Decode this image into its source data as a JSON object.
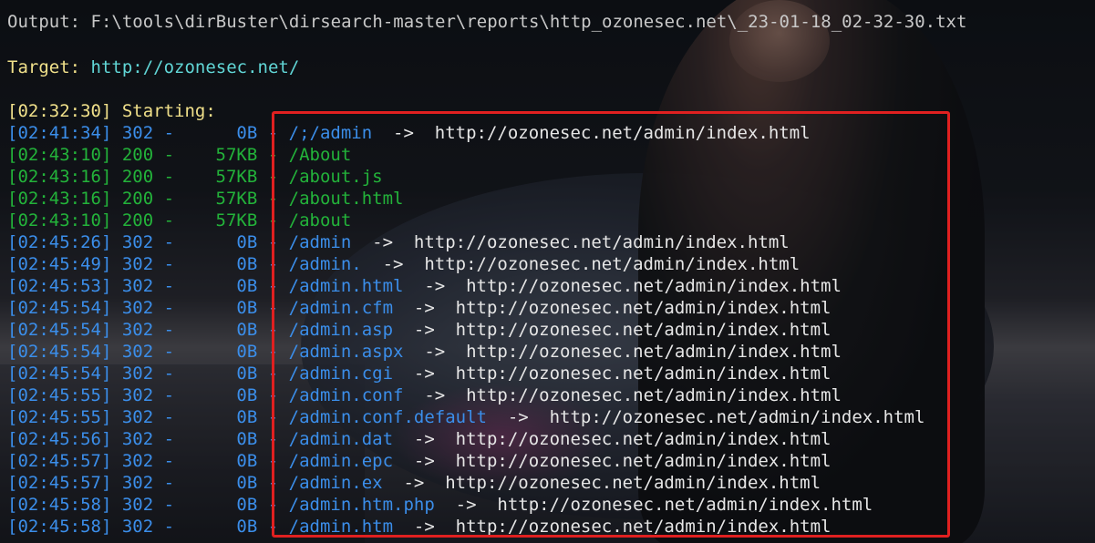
{
  "output": {
    "label": "Output:",
    "path": "F:\\tools\\dirBuster\\dirsearch-master\\reports\\http_ozonesec.net\\_23-01-18_02-32-30.txt"
  },
  "target": {
    "label": "Target:",
    "url": "http://ozonesec.net/"
  },
  "starting": {
    "time": "[02:32:30]",
    "text": "Starting:"
  },
  "rows": [
    {
      "time": "[02:41:34]",
      "status": "302",
      "size": "0B",
      "path": "/;/admin",
      "redirect": "http://ozonesec.net/admin/index.html"
    },
    {
      "time": "[02:43:10]",
      "status": "200",
      "size": "57KB",
      "path": "/About",
      "redirect": ""
    },
    {
      "time": "[02:43:16]",
      "status": "200",
      "size": "57KB",
      "path": "/about.js",
      "redirect": ""
    },
    {
      "time": "[02:43:16]",
      "status": "200",
      "size": "57KB",
      "path": "/about.html",
      "redirect": ""
    },
    {
      "time": "[02:43:10]",
      "status": "200",
      "size": "57KB",
      "path": "/about",
      "redirect": ""
    },
    {
      "time": "[02:45:26]",
      "status": "302",
      "size": "0B",
      "path": "/admin",
      "redirect": "http://ozonesec.net/admin/index.html"
    },
    {
      "time": "[02:45:49]",
      "status": "302",
      "size": "0B",
      "path": "/admin.",
      "redirect": "http://ozonesec.net/admin/index.html"
    },
    {
      "time": "[02:45:53]",
      "status": "302",
      "size": "0B",
      "path": "/admin.html",
      "redirect": "http://ozonesec.net/admin/index.html"
    },
    {
      "time": "[02:45:54]",
      "status": "302",
      "size": "0B",
      "path": "/admin.cfm",
      "redirect": "http://ozonesec.net/admin/index.html"
    },
    {
      "time": "[02:45:54]",
      "status": "302",
      "size": "0B",
      "path": "/admin.asp",
      "redirect": "http://ozonesec.net/admin/index.html"
    },
    {
      "time": "[02:45:54]",
      "status": "302",
      "size": "0B",
      "path": "/admin.aspx",
      "redirect": "http://ozonesec.net/admin/index.html"
    },
    {
      "time": "[02:45:54]",
      "status": "302",
      "size": "0B",
      "path": "/admin.cgi",
      "redirect": "http://ozonesec.net/admin/index.html"
    },
    {
      "time": "[02:45:55]",
      "status": "302",
      "size": "0B",
      "path": "/admin.conf",
      "redirect": "http://ozonesec.net/admin/index.html"
    },
    {
      "time": "[02:45:55]",
      "status": "302",
      "size": "0B",
      "path": "/admin.conf.default",
      "redirect": "http://ozonesec.net/admin/index.html"
    },
    {
      "time": "[02:45:56]",
      "status": "302",
      "size": "0B",
      "path": "/admin.dat",
      "redirect": "http://ozonesec.net/admin/index.html"
    },
    {
      "time": "[02:45:57]",
      "status": "302",
      "size": "0B",
      "path": "/admin.epc",
      "redirect": "http://ozonesec.net/admin/index.html"
    },
    {
      "time": "[02:45:57]",
      "status": "302",
      "size": "0B",
      "path": "/admin.ex",
      "redirect": "http://ozonesec.net/admin/index.html"
    },
    {
      "time": "[02:45:58]",
      "status": "302",
      "size": "0B",
      "path": "/admin.htm.php",
      "redirect": "http://ozonesec.net/admin/index.html"
    },
    {
      "time": "[02:45:58]",
      "status": "302",
      "size": "0B",
      "path": "/admin.htm",
      "redirect": "http://ozonesec.net/admin/index.html"
    }
  ],
  "colors": {
    "redirect_row": "#3b8eea",
    "ok_row": "#23b33a",
    "label": "#f0e08a",
    "url": "#61d6d6",
    "highlight_box": "#e02020"
  }
}
